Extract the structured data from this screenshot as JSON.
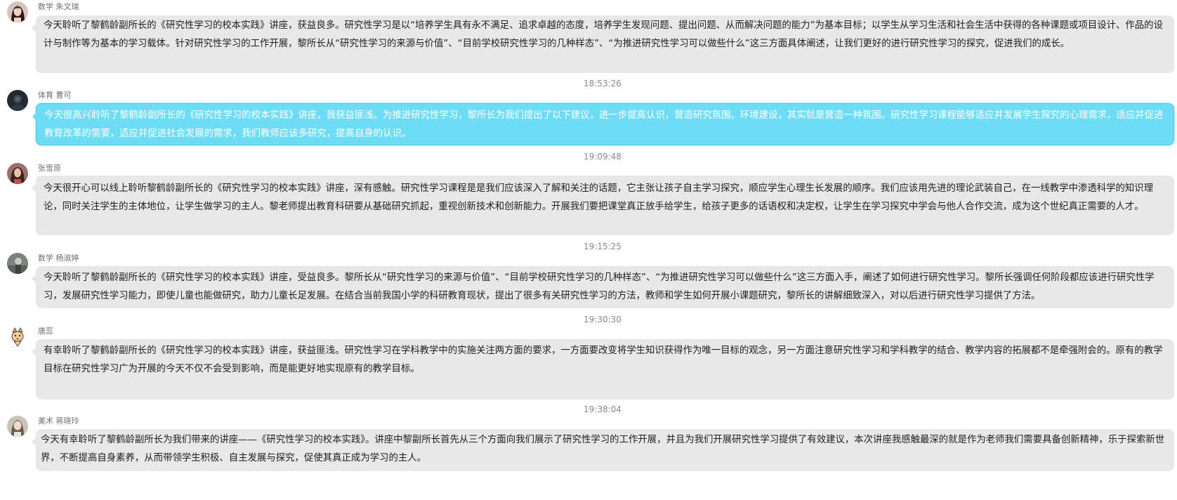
{
  "messages": [
    {
      "avatar": "avatar-woman-dark-hair",
      "sender": "数学 朱文瑞",
      "text": "今天聆听了黎鹤龄副所长的《研究性学习的校本实践》讲座，获益良多。研究性学习是以“培养学生具有永不满足、追求卓越的态度，培养学生发现问题、提出问题、从而解决问题的能力”为基本目标；以学生从学习生活和社会生活中获得的各种课题或项目设计、作品的设计与制作等为基本的学习载体。针对研究性学习的工作开展，黎所长从“研究性学习的来源与价值”、“目前学校研究性学习的几种样态”、“为推进研究性学习可以做些什么”这三方面具体阐述，让我们更好的进行研究性学习的探究，促进我们的成长。",
      "highlighted": false
    },
    {
      "avatar": "avatar-dark-photo",
      "sender": "体育 曹可",
      "text": "今天很高兴聆听了黎鹤龄副所长的《研究性学习的校本实践》讲座，我获益匪浅。为推进研究性学习，黎所长为我们提出了以下建议，进一步提高认识，营造研究氛围。环境建设，其实就是营造一种氛围。研究性学习课程能够适应并发展学生探究的心理需求，适应并促进教育改革的需要，适应并促进社会发展的需求，我们教师应该多研究，提高自身的认识。",
      "highlighted": true
    },
    {
      "avatar": "avatar-woman-portrait",
      "sender": "张雪原",
      "text": "今天很开心可以线上聆听黎鹤龄副所长的《研究性学习的校本实践》讲座，深有感触。研究性学习课程是是我们应该深入了解和关注的话题，它主张让孩子自主学习探究，顺应学生心理生长发展的顺序。我们应该用先进的理论武装自己，在一线教学中渗透科学的知识理论，同时关注学生的主体地位，让学生做学习的主人。黎老师提出教育科研要从基础研究抓起，重视创新技术和创新能力。开展我们要把课堂真正放手给学生，给孩子更多的话语权和决定权，让学生在学习探究中学会与他人合作交流，成为这个世纪真正需要的人才。",
      "highlighted": false
    },
    {
      "avatar": "avatar-gray-photo",
      "sender": "数学 杨淑婷",
      "text": "今天聆听了黎鹤龄副所长的《研究性学习的校本实践》讲座，受益良多。黎所长从“研究性学习的来源与价值”、“目前学校研究性学习的几种样态”、“为推进研究性学习可以做些什么”这三方面入手，阐述了如何进行研究性学习。黎所长强调任何阶段都应该进行研究性学习，发展研究性学习能力，即使儿童也能做研究，助力儿童长足发展。在结合当前我国小学的科研教育现状，提出了很多有关研究性学习的方法，教师和学生如何开展小课题研究，黎所长的讲解细致深入，对以后进行研究性学习提供了方法。",
      "highlighted": false
    },
    {
      "avatar": "avatar-cartoon-cat",
      "sender": "唐蕊",
      "text": "有幸聆听了黎鹤龄副所长的《研究性学习的校本实践》讲座，获益匪浅。研究性学习在学科教学中的实施关注两方面的要求，一方面要改变将学生知识获得作为唯一目标的观念，另一方面注意研究性学习和学科教学的结合、教学内容的拓展都不是牵强附会的。原有的教学目标在研究性学习广为开展的今天不仅不会受到影响，而是能更好地实现原有的教学目标。",
      "highlighted": false
    },
    {
      "avatar": "avatar-woman-light",
      "sender": "美术 蒋晓玲",
      "text": "今天有幸聆听了黎鹤龄副所长为我们带来的讲座——《研究性学习的校本实践》。讲座中黎副所长首先从三个方面向我们展示了研究性学习的工作开展，并且为我们开展研究性学习提供了有效建议，本次讲座我感触最深的就是作为老师我们需要具备创新精神，乐于探索新世界，不断提高自身素养，从而带领学生积极、自主发展与探究，促使其真正成为学习的主人。",
      "highlighted": false
    }
  ],
  "timestamps": [
    "18:53:26",
    "19:09:48",
    "19:15:25",
    "19:30:30",
    "19:38:04"
  ]
}
